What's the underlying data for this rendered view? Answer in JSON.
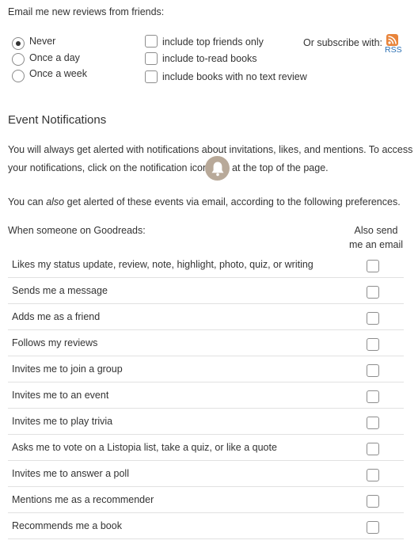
{
  "email_section": {
    "heading": "Email me new reviews from friends:",
    "radios": [
      {
        "label": "Never",
        "checked": true
      },
      {
        "label": "Once a day",
        "checked": false
      },
      {
        "label": "Once a week",
        "checked": false
      }
    ],
    "checkboxes": [
      {
        "label": "include top friends only"
      },
      {
        "label": "include to-read books"
      },
      {
        "label": "include books with no text review"
      }
    ],
    "subscribe_label": "Or subscribe with:",
    "rss_label": "RSS"
  },
  "event_section": {
    "title": "Event Notifications",
    "para1_line1": "You will always get alerted with notifications about invitations, likes, and mentions. To access",
    "para1_line2_before": "your notifications, click on the notification icon",
    "para1_line2_after": "at the top of the page.",
    "para2_before": "You can ",
    "para2_em": "also",
    "para2_after": " get alerted of these events via email, according to the following preferences.",
    "when_label": "When someone on Goodreads:",
    "also_send_line1": "Also send",
    "also_send_line2": "me an email",
    "rows": [
      {
        "label": "Likes my status update, review, note, highlight, photo, quiz, or writing"
      },
      {
        "label": "Sends me a message"
      },
      {
        "label": "Adds me as a friend"
      },
      {
        "label": "Follows my reviews"
      },
      {
        "label": "Invites me to join a group"
      },
      {
        "label": "Invites me to an event"
      },
      {
        "label": "Invites me to play trivia"
      },
      {
        "label": "Asks me to vote on a Listopia list, take a quiz, or like a quote"
      },
      {
        "label": "Invites me to answer a poll"
      },
      {
        "label": "Mentions me as a recommender"
      },
      {
        "label": "Recommends me a book"
      }
    ]
  },
  "colors": {
    "rss": "#e8843b",
    "link": "#2a6fb3",
    "bell_bg": "#b8a999"
  },
  "icons": {
    "rss": "rss-icon",
    "bell": "bell-icon"
  }
}
